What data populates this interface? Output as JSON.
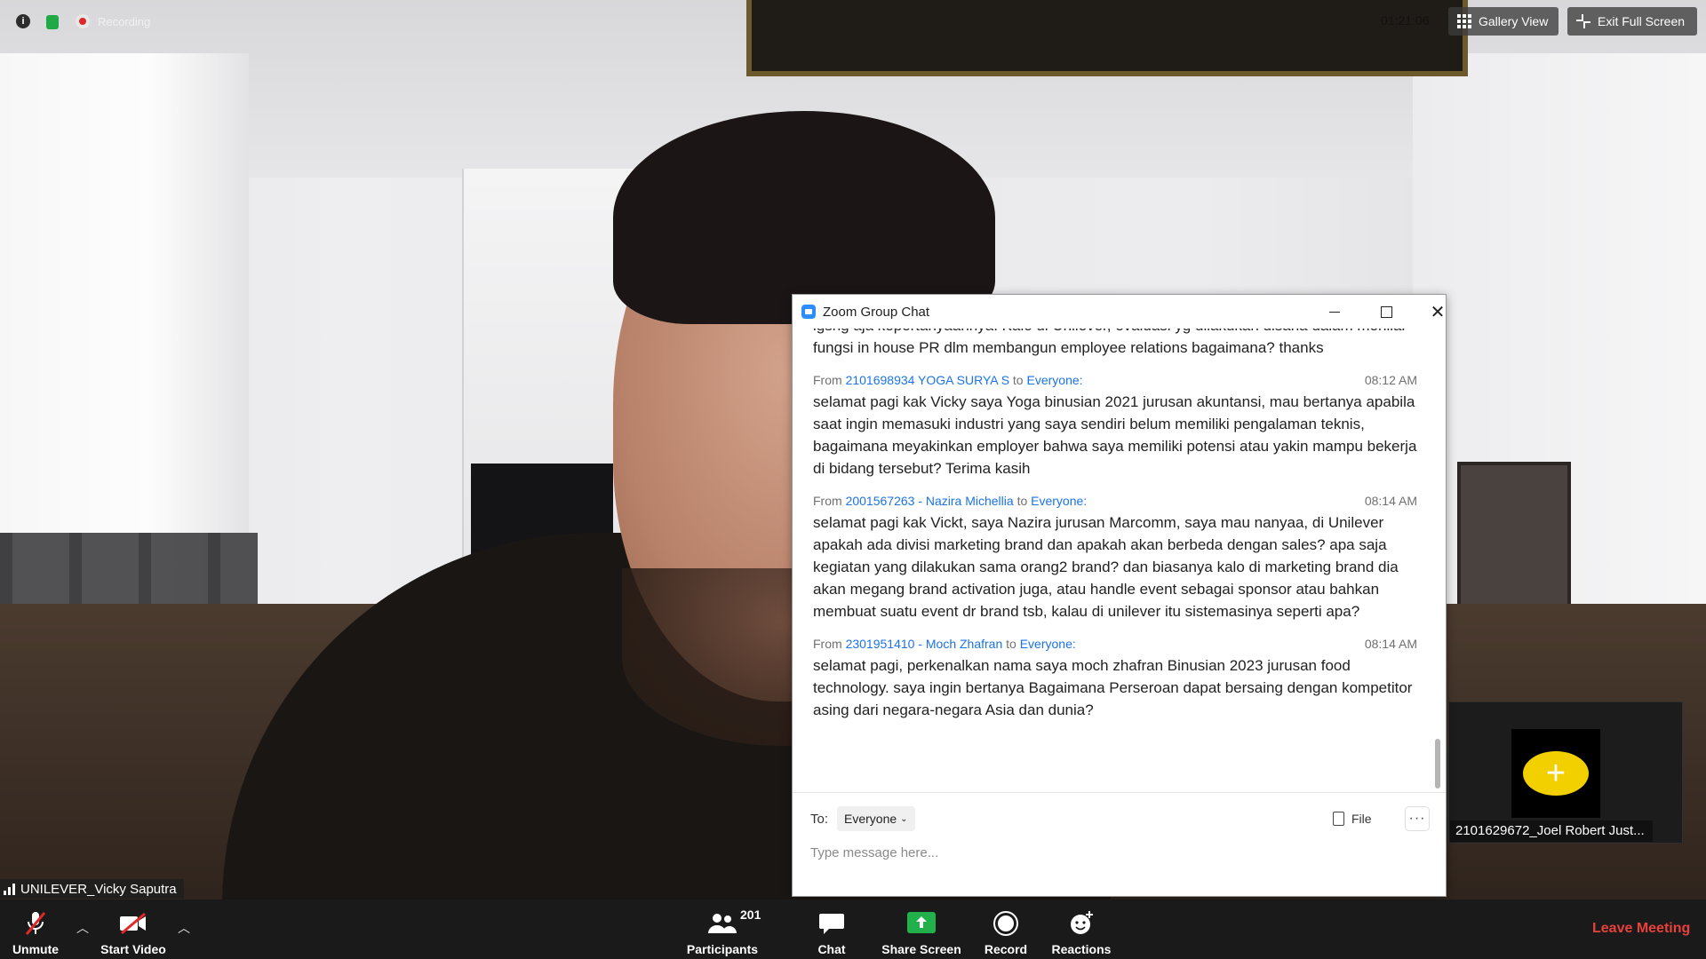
{
  "status_bar": {
    "recording_label": "Recording",
    "timer": "01:21:06",
    "gallery_view_label": "Gallery View",
    "exit_full_screen_label": "Exit Full Screen"
  },
  "speaker": {
    "name": "UNILEVER_Vicky Saputra"
  },
  "thumbnail": {
    "name": "2101629672_Joel Robert Just..."
  },
  "chat": {
    "title": "Zoom Group Chat",
    "partial_message": "lgsng aja kepertanyaannya. Kalo di Unilever, evaluasi yg dilakukan disana dalam menilai fungsi in house PR dlm membangun employee relations bagaimana? thanks",
    "messages": [
      {
        "from_label": "From",
        "sender": "2101698934 YOGA SURYA S",
        "to_label": "to",
        "recipient": "Everyone:",
        "time": "08:12 AM",
        "text": "selamat pagi kak Vicky saya Yoga binusian 2021 jurusan akuntansi, mau bertanya apabila saat ingin memasuki industri yang saya sendiri belum memiliki pengalaman teknis, bagaimana meyakinkan employer bahwa saya memiliki potensi atau yakin mampu bekerja di bidang tersebut? Terima kasih"
      },
      {
        "from_label": "From",
        "sender": "2001567263 - Nazira Michellia",
        "to_label": "to",
        "recipient": "Everyone:",
        "time": "08:14 AM",
        "text": "selamat pagi kak Vickt, saya Nazira jurusan Marcomm, saya mau nanyaa, di Unilever apakah ada divisi marketing brand dan apakah akan berbeda dengan sales? apa saja kegiatan yang dilakukan sama orang2 brand? dan biasanya kalo di marketing brand dia akan megang brand activation juga, atau handle event sebagai sponsor atau bahkan membuat suatu event dr brand tsb, kalau di unilever itu sistemasinya seperti apa?"
      },
      {
        "from_label": "From",
        "sender": "2301951410 - Moch Zhafran",
        "to_label": "to",
        "recipient": "Everyone:",
        "time": "08:14 AM",
        "text": "selamat pagi, perkenalkan nama saya moch zhafran Binusian 2023 jurusan food technology. saya ingin bertanya Bagaimana Perseroan dapat bersaing dengan kompetitor asing dari negara-negara Asia dan dunia?"
      }
    ],
    "to_label": "To:",
    "recipient_select": "Everyone",
    "file_label": "File",
    "more_label": "···",
    "input_placeholder": "Type message here..."
  },
  "toolbar": {
    "unmute_label": "Unmute",
    "start_video_label": "Start Video",
    "participants_label": "Participants",
    "participants_count": "201",
    "chat_label": "Chat",
    "share_screen_label": "Share Screen",
    "record_label": "Record",
    "reactions_label": "Reactions",
    "leave_label": "Leave Meeting"
  },
  "colors": {
    "link_blue": "#1a73e8",
    "leave_red": "#e8403a",
    "share_green": "#22b04b",
    "toolbar_bg": "#1a1a1a"
  }
}
